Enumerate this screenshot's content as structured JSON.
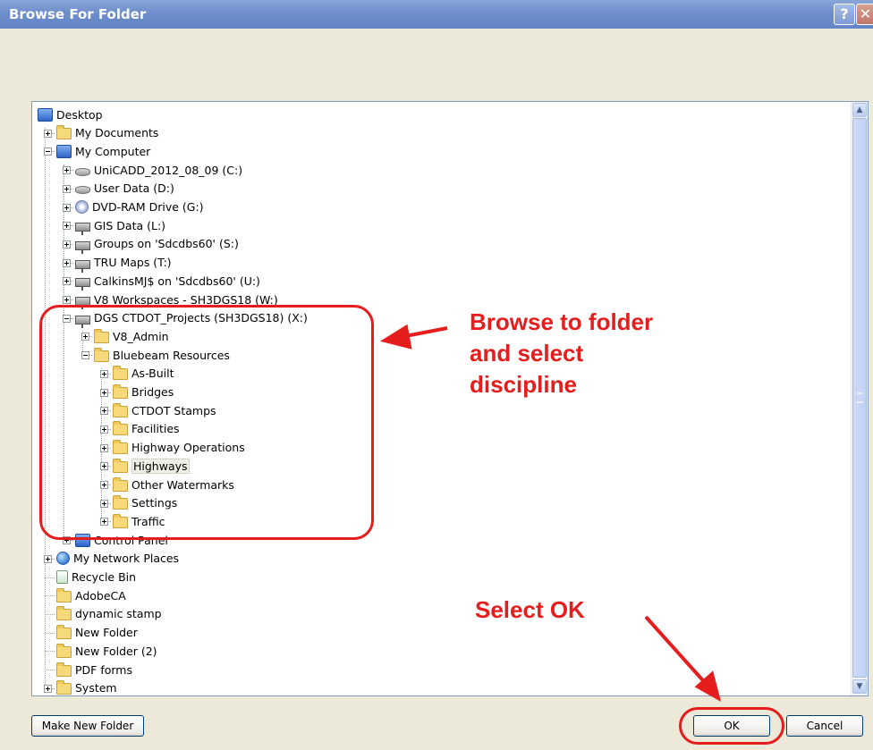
{
  "window": {
    "title": "Browse For Folder"
  },
  "tree": {
    "items": [
      {
        "label": "Desktop",
        "icon": "desktop-icon"
      },
      {
        "label": "My Documents",
        "icon": "folder-icon"
      },
      {
        "label": "My Computer",
        "icon": "computer-icon"
      },
      {
        "label": "UniCADD_2012_08_09 (C:)",
        "icon": "hard-drive-icon"
      },
      {
        "label": "User Data (D:)",
        "icon": "hard-drive-icon"
      },
      {
        "label": "DVD-RAM Drive (G:)",
        "icon": "dvd-drive-icon"
      },
      {
        "label": "GIS Data (L:)",
        "icon": "network-drive-icon"
      },
      {
        "label": "Groups on 'Sdcdbs60' (S:)",
        "icon": "network-drive-icon"
      },
      {
        "label": "TRU Maps (T:)",
        "icon": "network-drive-icon"
      },
      {
        "label": "CalkinsMJ$ on 'Sdcdbs60' (U:)",
        "icon": "network-drive-icon"
      },
      {
        "label": "V8 Workspaces - SH3DGS18 (W:)",
        "icon": "network-drive-icon"
      },
      {
        "label": "DGS CTDOT_Projects (SH3DGS18) (X:)",
        "icon": "network-drive-icon"
      },
      {
        "label": "V8_Admin",
        "icon": "folder-icon"
      },
      {
        "label": "Bluebeam Resources",
        "icon": "folder-icon"
      },
      {
        "label": "As-Built",
        "icon": "folder-icon"
      },
      {
        "label": "Bridges",
        "icon": "folder-icon"
      },
      {
        "label": "CTDOT Stamps",
        "icon": "folder-icon"
      },
      {
        "label": "Facilities",
        "icon": "folder-icon"
      },
      {
        "label": "Highway Operations",
        "icon": "folder-icon"
      },
      {
        "label": "Highways",
        "icon": "folder-icon",
        "selected": true
      },
      {
        "label": "Other Watermarks",
        "icon": "folder-icon"
      },
      {
        "label": "Settings",
        "icon": "folder-icon"
      },
      {
        "label": "Traffic",
        "icon": "folder-icon"
      },
      {
        "label": "Control Panel",
        "icon": "control-panel-icon"
      },
      {
        "label": "My Network Places",
        "icon": "network-places-icon"
      },
      {
        "label": "Recycle Bin",
        "icon": "recycle-bin-icon"
      },
      {
        "label": "AdobeCA",
        "icon": "folder-icon"
      },
      {
        "label": "dynamic stamp",
        "icon": "folder-icon"
      },
      {
        "label": "New Folder",
        "icon": "folder-icon"
      },
      {
        "label": "New Folder (2)",
        "icon": "folder-icon"
      },
      {
        "label": "PDF forms",
        "icon": "folder-icon"
      },
      {
        "label": "System",
        "icon": "folder-icon"
      }
    ]
  },
  "buttons": {
    "make_new_folder": "Make New Folder",
    "ok": "OK",
    "cancel": "Cancel"
  },
  "annotations": {
    "browse": [
      "Browse to folder",
      "and select",
      "discipline"
    ],
    "select_ok": "Select OK"
  },
  "colors": {
    "annotation": "#e51d1d",
    "titlebar": "#6d8dcb"
  }
}
